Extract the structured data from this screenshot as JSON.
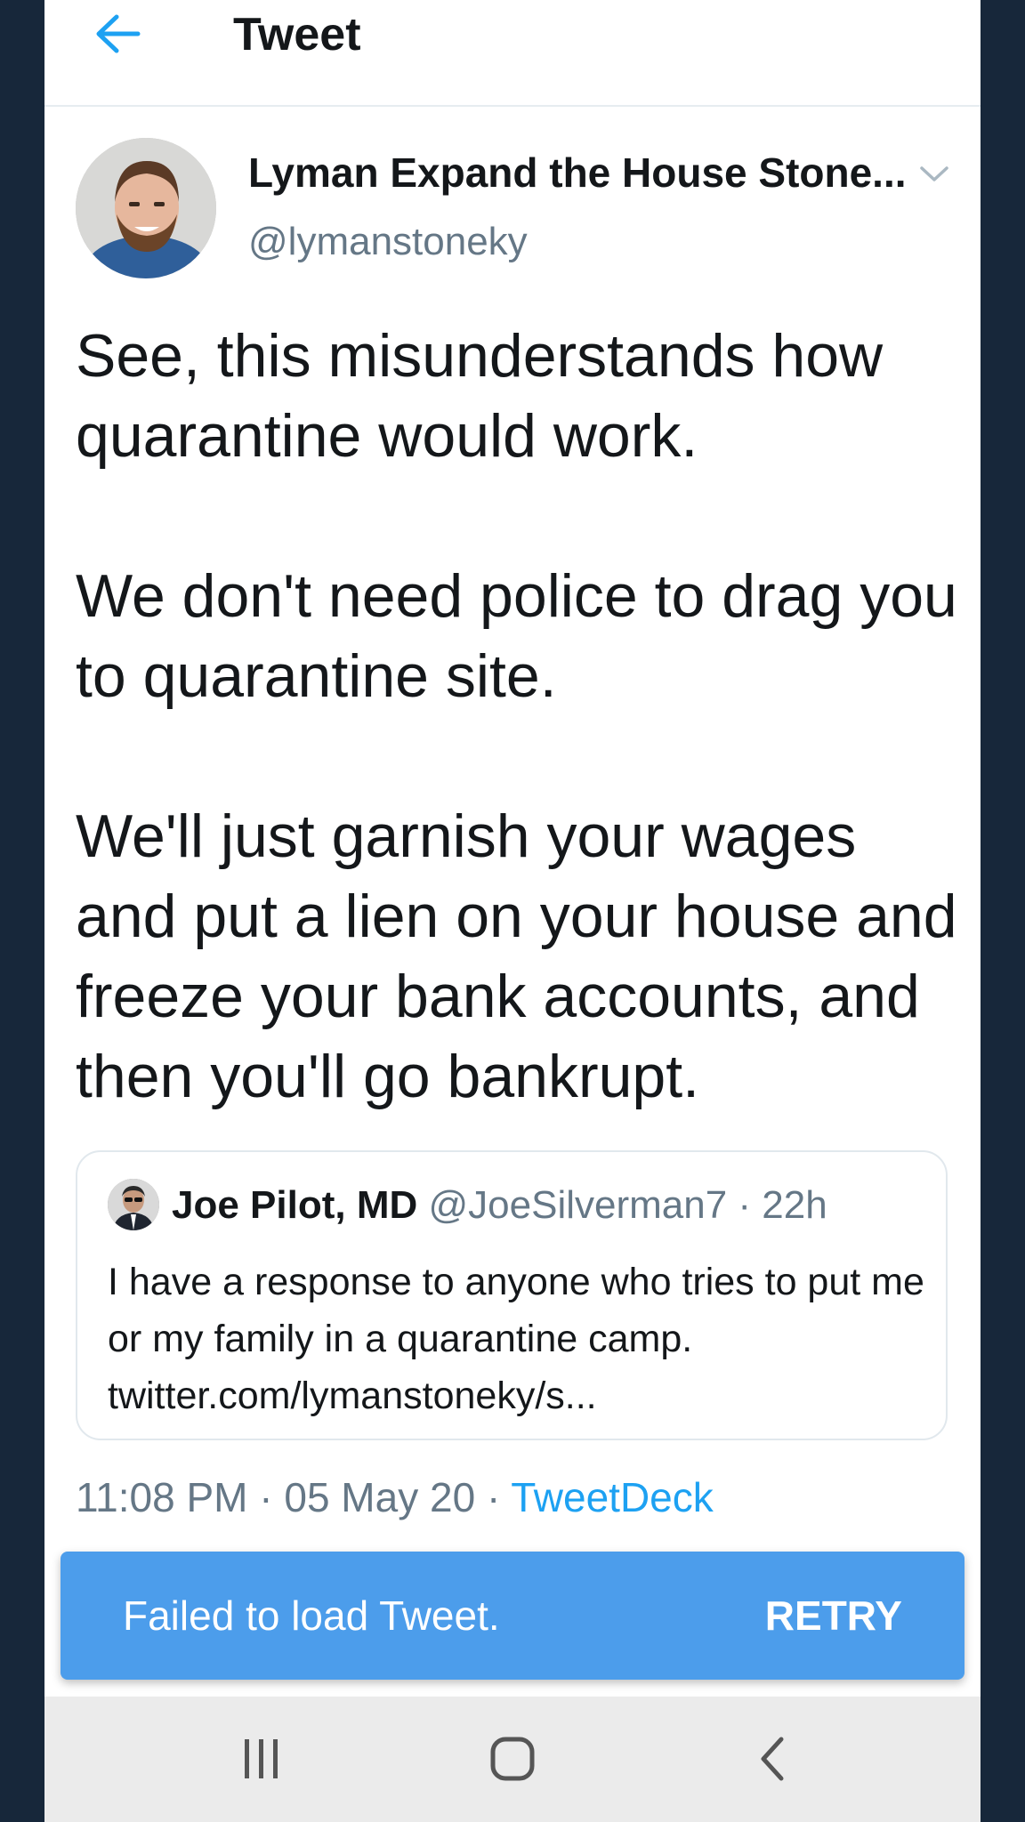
{
  "header": {
    "back_icon": "arrow-left-icon",
    "title": "Tweet",
    "accent_color": "#1da1f2"
  },
  "author": {
    "name": "Lyman Expand the House Stone...",
    "handle": "@lymanstoneky",
    "menu_icon": "chevron-down-icon"
  },
  "tweet": {
    "paragraphs": [
      "See, this misunderstands how quarantine would work.",
      "We don't need police to drag you to quarantine site.",
      "We'll just garnish your wages and put a lien on your house and freeze your bank accounts, and then you'll go bankrupt."
    ]
  },
  "quoted_tweet": {
    "name": "Joe Pilot, MD",
    "handle": "@JoeSilverman7",
    "time": "· 22h",
    "text": "I have a response to anyone who tries to put me or my family in a quarantine camp. twitter.com/lymanstoneky/s..."
  },
  "meta": {
    "time": "11:08 PM",
    "date": "· 05 May 20 ·",
    "source": "TweetDeck"
  },
  "snackbar": {
    "message": "Failed to load Tweet.",
    "action": "RETRY",
    "color": "#4c9deb"
  },
  "navbar": {
    "recents_icon": "recent-apps-icon",
    "home_icon": "home-icon",
    "back_icon": "back-chevron-icon"
  }
}
